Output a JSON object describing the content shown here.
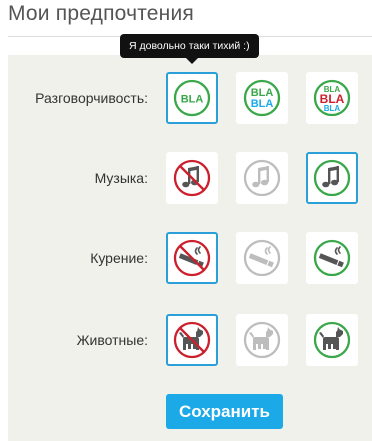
{
  "page": {
    "title": "Мои предпочтения"
  },
  "tooltip": {
    "text": "Я довольно таки тихий :)"
  },
  "colors": {
    "accent": "#2a9fd8",
    "yes": "#3aa84a",
    "no": "#cc1f2d",
    "neutral": "#bdbdbd",
    "blue": "#1ba9e8"
  },
  "rows": [
    {
      "label": "Разговорчивость:",
      "icon": "chat-icon",
      "selected": 0,
      "options": [
        {
          "level": "quiet",
          "lines": [
            "BLA"
          ]
        },
        {
          "level": "medium",
          "lines": [
            "BLA",
            "BLA"
          ]
        },
        {
          "level": "chatty",
          "lines": [
            "BLA",
            "BLA",
            "BLA"
          ]
        }
      ]
    },
    {
      "label": "Музыка:",
      "icon": "music-note-icon",
      "selected": 2,
      "options": [
        {
          "level": "no"
        },
        {
          "level": "maybe"
        },
        {
          "level": "yes"
        }
      ]
    },
    {
      "label": "Курение:",
      "icon": "cigarette-icon",
      "selected": 0,
      "options": [
        {
          "level": "no"
        },
        {
          "level": "maybe"
        },
        {
          "level": "yes"
        }
      ]
    },
    {
      "label": "Животные:",
      "icon": "dog-icon",
      "selected": 0,
      "options": [
        {
          "level": "no"
        },
        {
          "level": "maybe"
        },
        {
          "level": "yes"
        }
      ]
    }
  ],
  "save_button": {
    "label": "Сохранить"
  }
}
